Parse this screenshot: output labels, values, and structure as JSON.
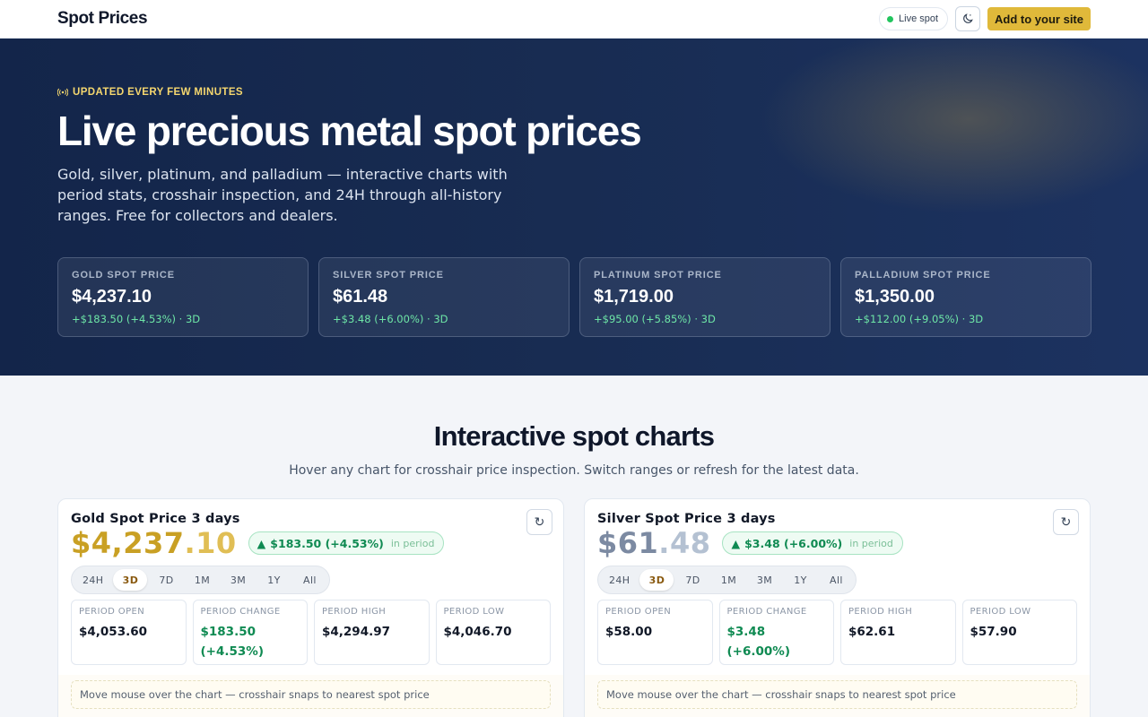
{
  "header": {
    "brand": "Spot Prices",
    "live_label": "Live spot",
    "theme_icon": "moon-icon",
    "cta_label": "Add to your site"
  },
  "hero": {
    "eyebrow": "UPDATED EVERY FEW MINUTES",
    "eyebrow_icon": "broadcast-icon",
    "title": "Live precious metal spot prices",
    "subtitle": "Gold, silver, platinum, and palladium — interactive charts with period stats, crosshair inspection, and 24H through all-history ranges. Free for collectors and dealers.",
    "metals": [
      {
        "label": "GOLD SPOT PRICE",
        "price": "$4,237.10",
        "change": "+$183.50 (+4.53%) · 3D"
      },
      {
        "label": "SILVER SPOT PRICE",
        "price": "$61.48",
        "change": "+$3.48 (+6.00%) · 3D"
      },
      {
        "label": "PLATINUM SPOT PRICE",
        "price": "$1,719.00",
        "change": "+$95.00 (+5.85%) · 3D"
      },
      {
        "label": "PALLADIUM SPOT PRICE",
        "price": "$1,350.00",
        "change": "+$112.00 (+9.05%) · 3D"
      }
    ]
  },
  "charts_section": {
    "title": "Interactive spot charts",
    "subtitle": "Hover any chart for crosshair price inspection. Switch ranges or refresh for the latest data.",
    "range_tabs": [
      "24H",
      "3D",
      "7D",
      "1M",
      "3M",
      "1Y",
      "All"
    ],
    "active_range": "3D",
    "cards": [
      {
        "title": "Gold Spot Price 3 days",
        "price_int": "$4,237",
        "price_dec": ".10",
        "change": "$183.50 (+4.53%)",
        "change_suffix": "in period",
        "stats": [
          {
            "label": "PERIOD OPEN",
            "value": "$4,053.60"
          },
          {
            "label": "PERIOD CHANGE",
            "value": "$183.50",
            "value2": "(+4.53%)"
          },
          {
            "label": "PERIOD HIGH",
            "value": "$4,294.97"
          },
          {
            "label": "PERIOD LOW",
            "value": "$4,046.70"
          }
        ],
        "hint": "Move mouse over the chart — crosshair snaps to nearest spot price"
      },
      {
        "title": "Silver Spot Price 3 days",
        "price_int": "$61",
        "price_dec": ".48",
        "change": "$3.48 (+6.00%)",
        "change_suffix": "in period",
        "stats": [
          {
            "label": "PERIOD OPEN",
            "value": "$58.00"
          },
          {
            "label": "PERIOD CHANGE",
            "value": "$3.48",
            "value2": "(+6.00%)"
          },
          {
            "label": "PERIOD HIGH",
            "value": "$62.61"
          },
          {
            "label": "PERIOD LOW",
            "value": "$57.90"
          }
        ],
        "hint": "Move mouse over the chart — crosshair snaps to nearest spot price"
      }
    ]
  },
  "colors": {
    "gold": "#c9a024",
    "silver": "#7c8aa2",
    "positive": "#0f8a52",
    "accent": "#e0b93a",
    "hero_bg": "#182c52"
  }
}
